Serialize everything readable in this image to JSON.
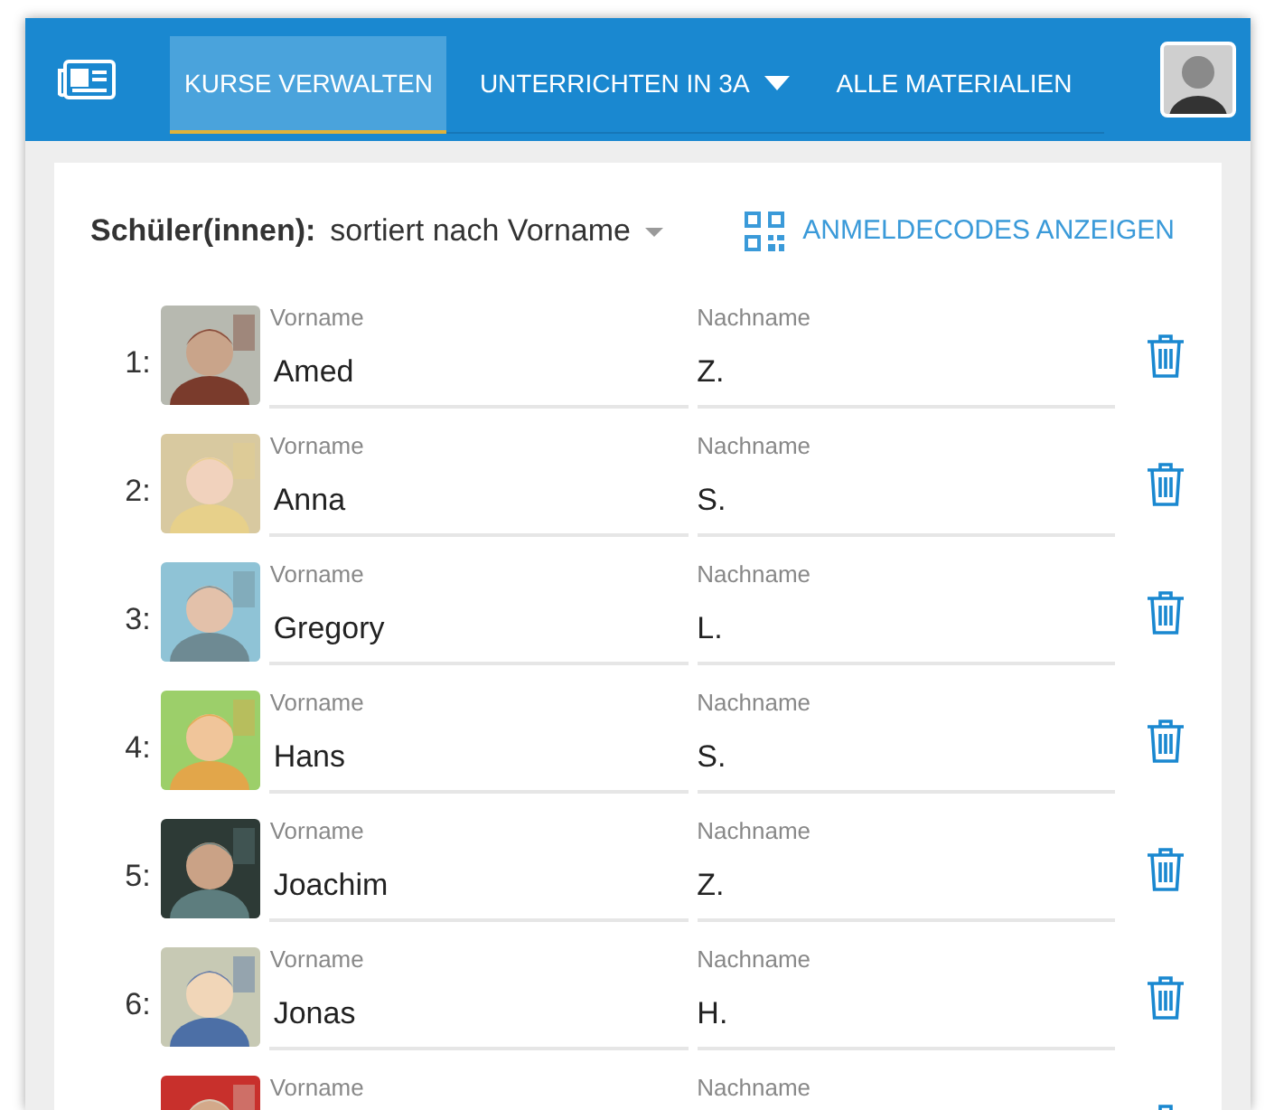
{
  "nav": {
    "tabs": [
      {
        "label": "KURSE VERWALTEN",
        "selected": true,
        "dropdown": false
      },
      {
        "label": "UNTERRICHTEN IN 3A",
        "selected": false,
        "dropdown": true
      },
      {
        "label": "ALLE MATERIALIEN",
        "selected": false,
        "dropdown": false
      }
    ]
  },
  "toolbar": {
    "label": "Schüler(innen):",
    "sort": "sortiert nach Vorname",
    "action": "ANMELDECODES ANZEIGEN"
  },
  "students": [
    {
      "number": "1:",
      "first_label": "Vorname",
      "first": "Amed",
      "last_label": "Nachname",
      "last": "Z."
    },
    {
      "number": "2:",
      "first_label": "Vorname",
      "first": "Anna",
      "last_label": "Nachname",
      "last": "S."
    },
    {
      "number": "3:",
      "first_label": "Vorname",
      "first": "Gregory",
      "last_label": "Nachname",
      "last": "L."
    },
    {
      "number": "4:",
      "first_label": "Vorname",
      "first": "Hans",
      "last_label": "Nachname",
      "last": "S."
    },
    {
      "number": "5:",
      "first_label": "Vorname",
      "first": "Joachim",
      "last_label": "Nachname",
      "last": "Z."
    },
    {
      "number": "6:",
      "first_label": "Vorname",
      "first": "Jonas",
      "last_label": "Nachname",
      "last": "H."
    },
    {
      "first_label": "Vorname",
      "last_label": "Nachname"
    }
  ]
}
